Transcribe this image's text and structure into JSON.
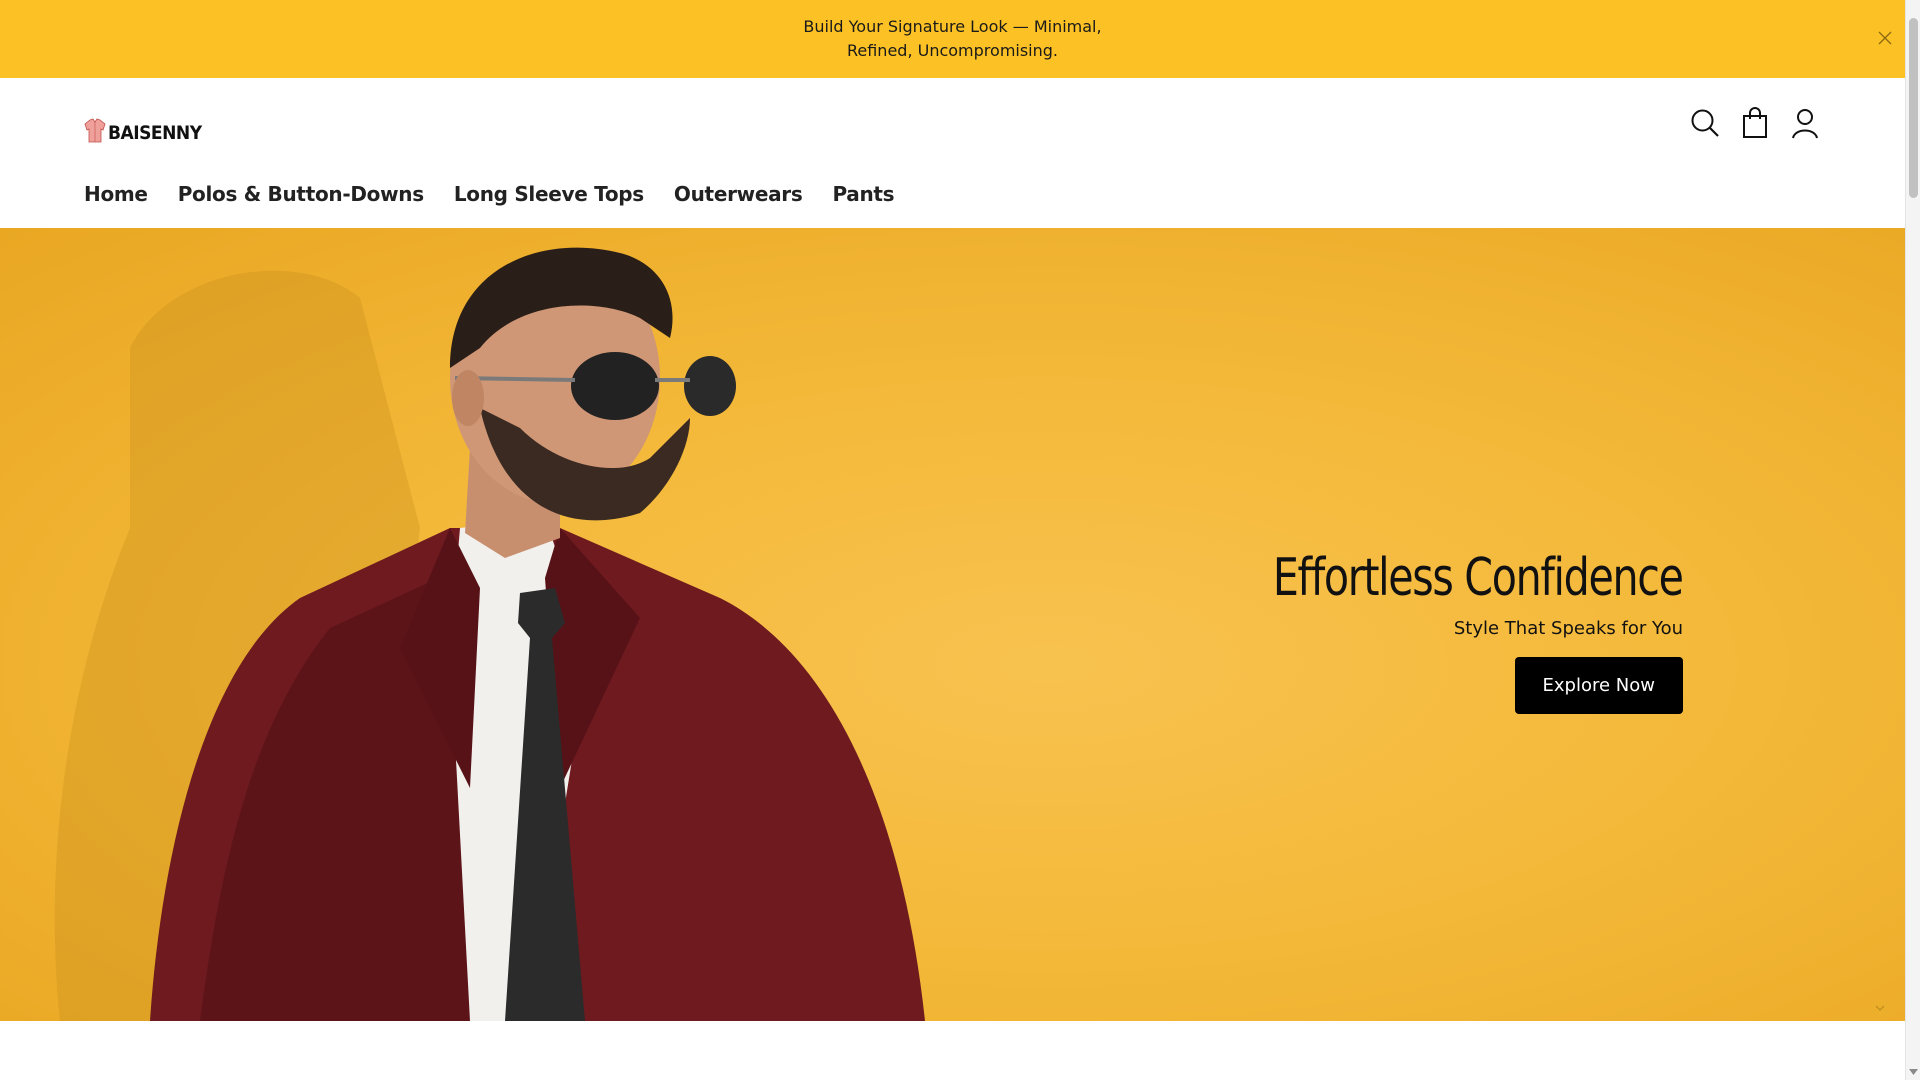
{
  "announcement": {
    "text": "Build Your Signature Look — Minimal, Refined, Uncompromising.",
    "close_icon": "close-icon"
  },
  "header": {
    "logo_text": "BAISENNY",
    "icons": [
      "search-icon",
      "cart-icon",
      "account-icon"
    ]
  },
  "nav": {
    "items": [
      {
        "label": "Home"
      },
      {
        "label": "Polos & Button-Downs"
      },
      {
        "label": "Long Sleeve Tops"
      },
      {
        "label": "Outerwears"
      },
      {
        "label": "Pants"
      }
    ]
  },
  "hero": {
    "title": "Effortless Confidence",
    "subtitle": "Style That Speaks for You",
    "button_label": "Explore Now"
  },
  "colors": {
    "announcement_bg": "#fcc124",
    "hero_bg": "#f4b93a",
    "button_bg": "#000000",
    "suit": "#6e1a1f"
  }
}
